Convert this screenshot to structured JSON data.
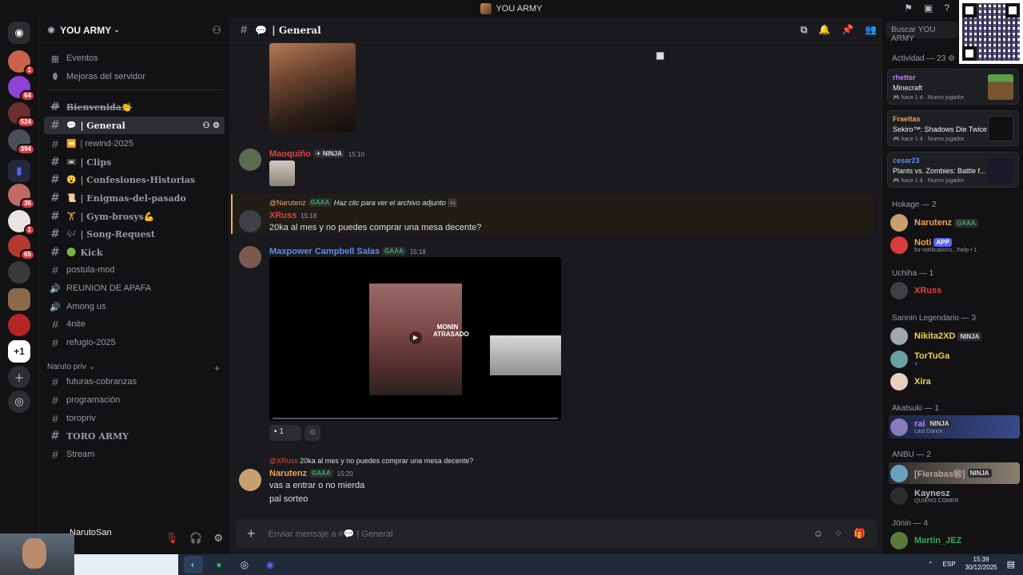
{
  "window": {
    "title": "YOU ARMY"
  },
  "server": {
    "name": "YOU ARMY"
  },
  "rail_badges": [
    "1",
    "64",
    "524",
    "394",
    "36",
    "1",
    "65"
  ],
  "channels": {
    "top": [
      "Eventos",
      "Mejoras del servidor"
    ],
    "list": [
      {
        "label": "Bienvenida👏",
        "icon": ""
      },
      {
        "label": "| General",
        "icon": "💬"
      },
      {
        "label": "| rewind-2025",
        "icon": "⏪"
      },
      {
        "label": "| Clips",
        "icon": "📼"
      },
      {
        "label": "| Confesiones-Historias",
        "icon": "😮"
      },
      {
        "label": "| Enigmas-del-pasado",
        "icon": "📜"
      },
      {
        "label": "| Gym-brosys💪",
        "icon": "🏋"
      },
      {
        "label": "| Song-Request",
        "icon": "🎶"
      },
      {
        "label": "Kick",
        "icon": "🟢"
      },
      {
        "label": "postula-mod",
        "icon": ""
      },
      {
        "label": "REUNION DE APAFA",
        "icon": ""
      },
      {
        "label": "Among us",
        "icon": ""
      },
      {
        "label": "4nite",
        "icon": ""
      },
      {
        "label": "refugio-2025",
        "icon": ""
      }
    ],
    "category": "Naruto priv",
    "list2": [
      "futuras-cobranzas",
      "programación",
      "toropriv",
      "TORO ARMY",
      "Stream"
    ]
  },
  "user": {
    "name": "NarutoSan"
  },
  "chat": {
    "channel": "| General",
    "search_placeholder": "Buscar YOU ARMY",
    "composer_placeholder": "Enviar mensaje a #💬 | General",
    "messages": [
      {
        "author": "Maoquiño",
        "tag": "NINJA",
        "time": "15:10",
        "color": "#e0443e"
      },
      {
        "reply_to": "@Narutenz",
        "reply_tag": "GAAA",
        "reply_text": "Haz clic para ver el archivo adjunto",
        "author": "XRuss",
        "time": "15:18",
        "text": "20ka al mes y no puedes comprar una mesa decente?",
        "color": "#e0443e"
      },
      {
        "author": "Maxpower Campbell Salas",
        "tag": "GAAA",
        "time": "15:18",
        "color": "#5b8def",
        "video_caption": "MONIN ATRASADO",
        "reaction_count": "1"
      },
      {
        "reply_to": "@XRuss",
        "reply_text": "20ka al mes y no puedes comprar una mesa decente?",
        "author": "Narutenz",
        "tag": "GAAA",
        "time": "15:20",
        "lines": [
          "vas a entrar o no mierda",
          "pal sorteo"
        ],
        "color": "#f0a15a"
      }
    ]
  },
  "members": {
    "activity_header": "Actividad — 23",
    "activity": [
      {
        "who": "rhetter",
        "game": "Minecraft",
        "meta": "hace 1 d",
        "meta2": "Nuevo jugador",
        "color": "#c27cff"
      },
      {
        "who": "Fraeltas",
        "game": "Sekiro™: Shadows Die Twice",
        "meta": "hace 1 d",
        "meta2": "Nuevo jugador",
        "color": "#f0a15a"
      },
      {
        "who": "cesar23",
        "game": "Plants vs. Zombies: Battle f...",
        "meta": "hace 1 d",
        "meta2": "Nuevo jugador",
        "color": "#5b8def"
      }
    ],
    "groups": [
      {
        "title": "Hokage — 2",
        "members": [
          {
            "name": "Narutenz",
            "tag": "GAAA",
            "color": "#f0a15a"
          },
          {
            "name": "Noti",
            "tag": "APP",
            "status": "for notifications.. /help • 1",
            "color": "#f0a15a"
          }
        ]
      },
      {
        "title": "Uchiha — 1",
        "members": [
          {
            "name": "XRuss",
            "color": "#e0443e"
          }
        ]
      },
      {
        "title": "Sannin Legendario — 3",
        "members": [
          {
            "name": "Nikita2XD",
            "tag": "NINJA",
            "color": "#f0d050"
          },
          {
            "name": "TorTuGa",
            "status": "⚡",
            "color": "#f0d050"
          },
          {
            "name": "Xira",
            "color": "#f0d050"
          }
        ]
      },
      {
        "title": "Akatsuki — 1",
        "members": [
          {
            "name": "rai",
            "tag": "NINJA",
            "status": "Last Dance",
            "color": "#c27cff"
          }
        ]
      },
      {
        "title": "ANBU — 2",
        "members": [
          {
            "name": "[Fierabas㊗]",
            "tag": "NINJA",
            "color": "#b5a0a0"
          },
          {
            "name": "Kaynesz",
            "status": "QUIERO COMER",
            "color": "#b5bac1"
          }
        ]
      },
      {
        "title": "Jönin — 4",
        "members": [
          {
            "name": "Martin_JEZ",
            "color": "#3ba55d"
          }
        ]
      }
    ]
  },
  "taskbar": {
    "lang": "ESP",
    "time": "15:39",
    "date": "30/12/2025"
  }
}
